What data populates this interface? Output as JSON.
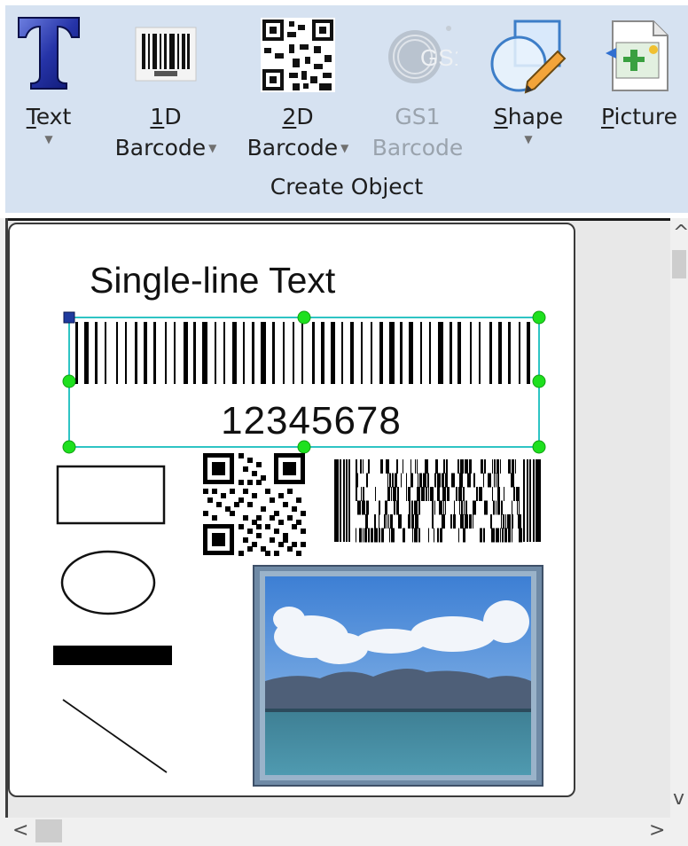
{
  "ribbon": {
    "buttons": [
      {
        "id": "text",
        "mnemonic": "T",
        "label_rest": "ext",
        "has_dropdown": true,
        "enabled": true
      },
      {
        "id": "barcode1d",
        "mnemonic": "1",
        "label_rest": "D",
        "line2": "Barcode",
        "has_dropdown": true,
        "enabled": true
      },
      {
        "id": "barcode2d",
        "mnemonic": "2",
        "label_rest": "D",
        "line2": "Barcode",
        "has_dropdown": true,
        "enabled": true
      },
      {
        "id": "gs1",
        "label": "GS1",
        "line2": "Barcode",
        "enabled": false
      },
      {
        "id": "shape",
        "mnemonic": "S",
        "label_rest": "hape",
        "has_dropdown": true,
        "enabled": true
      },
      {
        "id": "picture",
        "mnemonic": "P",
        "label_rest": "icture",
        "enabled": true
      }
    ],
    "group_label": "Create Object"
  },
  "canvas": {
    "single_line_text": "Single-line Text",
    "barcode_value": "12345678"
  },
  "scrollbars": {
    "up_arrow": "^",
    "down_arrow": "v",
    "left_arrow": "<",
    "right_arrow": ">"
  },
  "colors": {
    "ribbon_bg": "#d6e2f1",
    "selection_outline": "#2ec4c4",
    "selection_handle": "#1ee01e",
    "anchor_handle": "#1f3a9e",
    "disabled_text": "#9aa3ad"
  }
}
